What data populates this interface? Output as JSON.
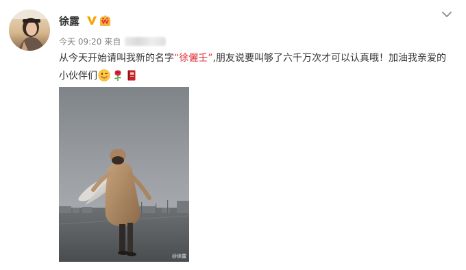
{
  "user": {
    "name": "徐露"
  },
  "meta": {
    "time": "今天 09:20",
    "source_prefix": "来自"
  },
  "post": {
    "text_before": "从今天开始请叫我新的名字",
    "quote_open": "“",
    "new_name": "徐儷壬",
    "quote_close": "”",
    "text_after": ",朋友说要叫够了六千万次才可以认真哦！加油我亲爱的小伙伴们"
  },
  "emojis": [
    "tongue-face-emoji",
    "rose-emoji",
    "red-notebook-emoji"
  ],
  "photo": {
    "watermark": "@徐露"
  },
  "colors": {
    "name_highlight": "#e0373d",
    "meta_gray": "#808080",
    "v_badge": "#f7a400"
  }
}
